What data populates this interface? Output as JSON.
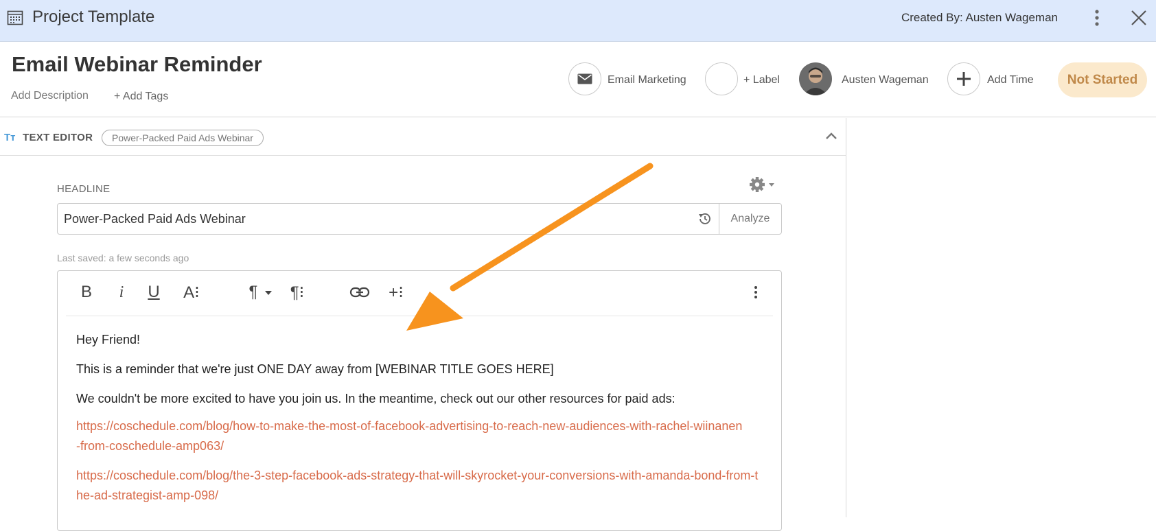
{
  "topbar": {
    "title": "Project Template",
    "created_by": "Created By: Austen Wageman"
  },
  "project": {
    "title": "Email Webinar Reminder",
    "add_description": "Add Description",
    "add_tags": "+ Add Tags",
    "type_label": "Email Marketing",
    "label_button": "+ Label",
    "owner_name": "Austen Wageman",
    "add_time": "Add Time",
    "status": "Not Started"
  },
  "editor_panel": {
    "icon_glyph": "Tт",
    "title": "TEXT EDITOR",
    "pill": "Power-Packed Paid Ads Webinar",
    "headline_label": "HEADLINE",
    "headline_value": "Power-Packed Paid Ads Webinar",
    "analyze": "Analyze",
    "last_saved": "Last saved: a few seconds ago"
  },
  "toolbar": {
    "bold": "B",
    "italic": "i",
    "underline": "U",
    "font_size": "A⁝",
    "paragraph": "¶",
    "paragraph_options": "¶⁝",
    "insert": "+⁝"
  },
  "body": {
    "greeting": "Hey Friend!",
    "line1": "This is a reminder that we're just ONE DAY away from [WEBINAR TITLE GOES HERE]",
    "line2": "We couldn't be more excited to have you join us. In the meantime, check out our other resources for paid ads:",
    "link1": "https://coschedule.com/blog/how-to-make-the-most-of-facebook-advertising-to-reach-new-audiences-with-rachel-wiinanen-from-coschedule-amp063/",
    "link2": "https://coschedule.com/blog/the-3-step-facebook-ads-strategy-that-will-skyrocket-your-conversions-with-amanda-bond-from-the-ad-strategist-amp-098/"
  },
  "colors": {
    "topbar_bg": "#dde9fc",
    "status_bg": "#fbe9cc",
    "status_text": "#c0894a",
    "link": "#d86b4a",
    "annotation_arrow": "#f7931e"
  }
}
